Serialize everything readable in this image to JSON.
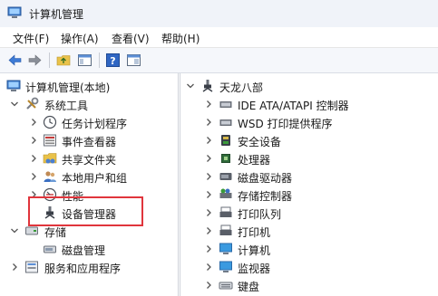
{
  "window": {
    "title": "计算机管理",
    "icon": "computer-management-icon"
  },
  "menu": {
    "file": "文件(F)",
    "action": "操作(A)",
    "view": "查看(V)",
    "help": "帮助(H)"
  },
  "toolbar": {
    "buttons": [
      "back-arrow-icon",
      "forward-arrow-icon",
      "folder-up-icon",
      "show-hide-tree-icon",
      "help-icon",
      "console-pane-icon"
    ]
  },
  "left_tree": {
    "root": "计算机管理(本地)",
    "system_tools": "系统工具",
    "task_scheduler": "任务计划程序",
    "event_viewer": "事件查看器",
    "shared_folders": "共享文件夹",
    "local_users": "本地用户和组",
    "performance": "性能",
    "device_manager": "设备管理器",
    "storage": "存储",
    "disk_management": "磁盘管理",
    "services_apps": "服务和应用程序"
  },
  "right_tree": {
    "root": "天龙八部",
    "items": [
      {
        "label": "IDE ATA/ATAPI 控制器",
        "icon": "ide-controller-icon"
      },
      {
        "label": "WSD 打印提供程序",
        "icon": "printer-provider-icon"
      },
      {
        "label": "安全设备",
        "icon": "security-device-icon"
      },
      {
        "label": "处理器",
        "icon": "processor-icon"
      },
      {
        "label": "磁盘驱动器",
        "icon": "disk-drive-icon"
      },
      {
        "label": "存储控制器",
        "icon": "storage-controller-icon"
      },
      {
        "label": "打印队列",
        "icon": "print-queue-icon"
      },
      {
        "label": "打印机",
        "icon": "printer-icon"
      },
      {
        "label": "计算机",
        "icon": "computer-icon"
      },
      {
        "label": "监视器",
        "icon": "monitor-icon"
      },
      {
        "label": "键盘",
        "icon": "keyboard-icon"
      }
    ]
  },
  "colors": {
    "highlight": "#e0353c",
    "titlebar": "#f0f3f9"
  }
}
